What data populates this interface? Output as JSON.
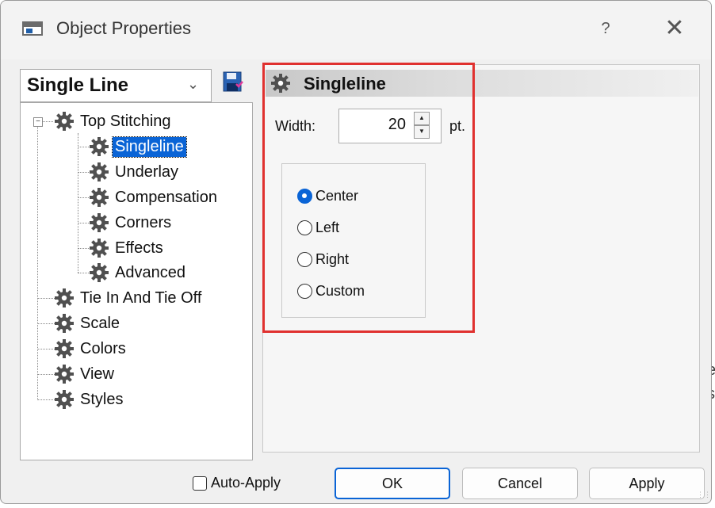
{
  "window": {
    "title": "Object Properties",
    "help_label": "?",
    "close_label": "✕"
  },
  "backdrop": {
    "fragments": [
      "e",
      "s"
    ]
  },
  "left": {
    "combo_value": "Single Line",
    "save_icon": "save-properties-icon",
    "expander_label": "−",
    "tree": {
      "root": "Top Stitching",
      "children": [
        "Singleline",
        "Underlay",
        "Compensation",
        "Corners",
        "Effects",
        "Advanced"
      ],
      "others": [
        "Tie In And Tie Off",
        "Scale",
        "Colors",
        "View",
        "Styles"
      ]
    }
  },
  "section": {
    "title": "Singleline",
    "width_label": "Width:",
    "width_value": "20",
    "width_unit": "pt.",
    "alignment_options": [
      "Center",
      "Left",
      "Right",
      "Custom"
    ],
    "selected_alignment": "Center"
  },
  "footer": {
    "auto_apply_label": "Auto-Apply",
    "auto_apply_checked": false,
    "ok_label": "OK",
    "cancel_label": "Cancel",
    "apply_label": "Apply"
  },
  "colors": {
    "accent": "#0a64d6",
    "highlight_border": "#e0312f"
  }
}
